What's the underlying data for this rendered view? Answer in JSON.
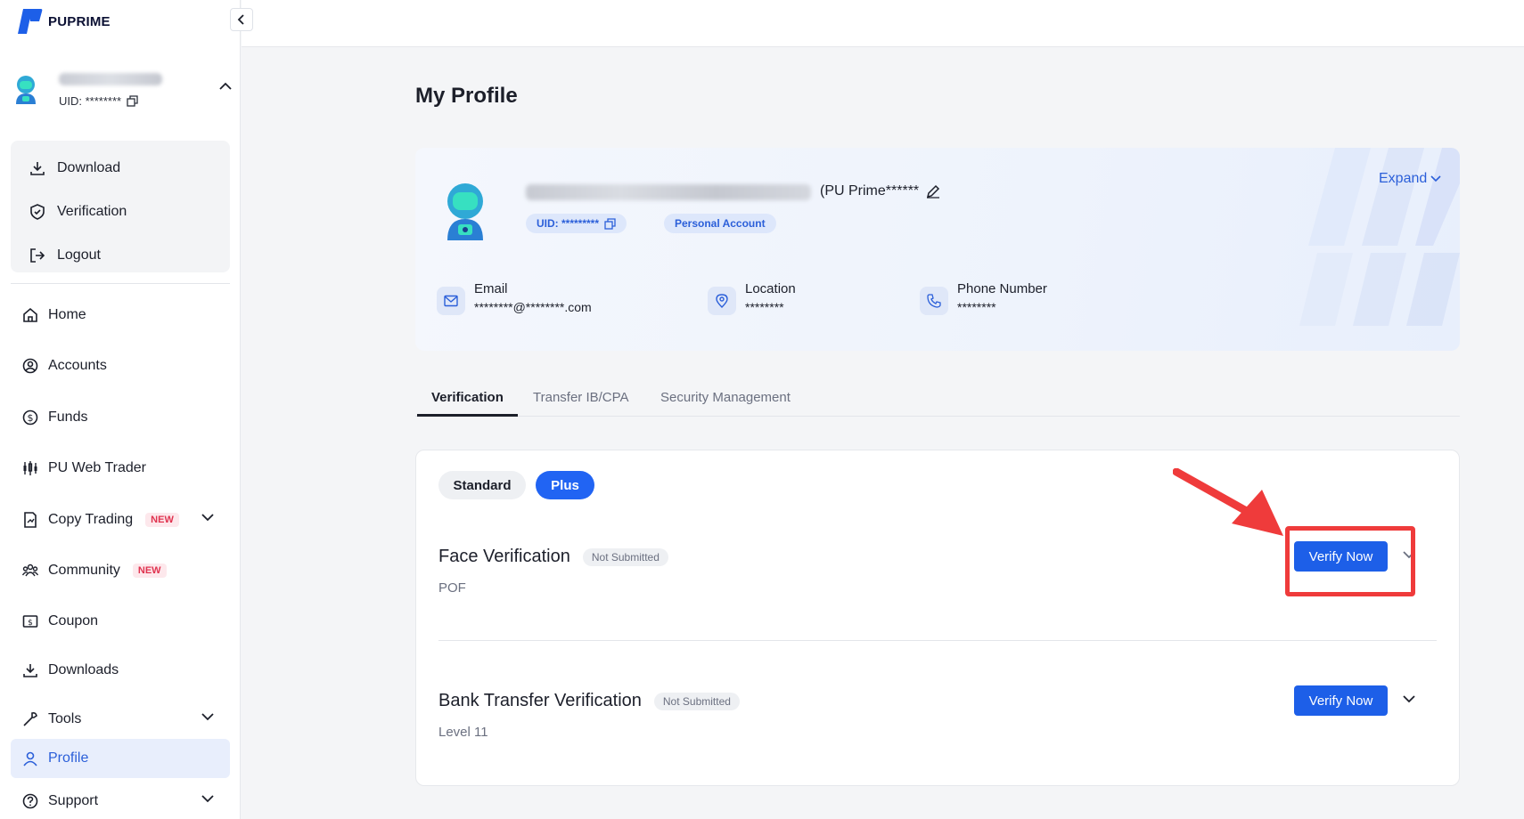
{
  "brand": {
    "name": "PUPRIME",
    "accent": "#1d5fe8",
    "highlight": "#ef3b3b"
  },
  "sidebar": {
    "user": {
      "uid": "UID: ********"
    },
    "quick_menu": [
      {
        "label": "Download",
        "icon": "download-icon"
      },
      {
        "label": "Verification",
        "icon": "shield-check-icon"
      },
      {
        "label": "Logout",
        "icon": "logout-icon"
      }
    ],
    "nav": [
      {
        "label": "Home",
        "icon": "home-icon"
      },
      {
        "label": "Accounts",
        "icon": "user-circle-icon"
      },
      {
        "label": "Funds",
        "icon": "dollar-circle-icon"
      },
      {
        "label": "PU Web Trader",
        "icon": "candlestick-icon"
      },
      {
        "label": "Copy Trading",
        "icon": "copy-trading-icon",
        "badge": "NEW"
      },
      {
        "label": "Community",
        "icon": "community-icon",
        "badge": "NEW"
      },
      {
        "label": "Coupon",
        "icon": "coupon-icon"
      },
      {
        "label": "Downloads",
        "icon": "download-icon"
      },
      {
        "label": "Tools",
        "icon": "wrench-icon"
      },
      {
        "label": "Profile",
        "icon": "user-icon",
        "active": true
      },
      {
        "label": "Support",
        "icon": "help-circle-icon"
      }
    ]
  },
  "main": {
    "title": "My Profile",
    "profile_card": {
      "name_suffix": "(PU Prime******",
      "uid": "UID: *********",
      "account_type": "Personal Account",
      "expand_label": "Expand",
      "email_label": "Email",
      "email_value": "********@********.com",
      "location_label": "Location",
      "location_value": "********",
      "phone_label": "Phone Number",
      "phone_value": "********"
    },
    "tabs": [
      "Verification",
      "Transfer IB/CPA",
      "Security Management"
    ],
    "verification": {
      "levels": [
        "Standard",
        "Plus"
      ],
      "items": [
        {
          "title": "Face Verification",
          "status": "Not Submitted",
          "sub": "POF",
          "button": "Verify Now"
        },
        {
          "title": "Bank Transfer Verification",
          "status": "Not Submitted",
          "sub": "Level 11",
          "button": "Verify Now"
        }
      ]
    }
  }
}
